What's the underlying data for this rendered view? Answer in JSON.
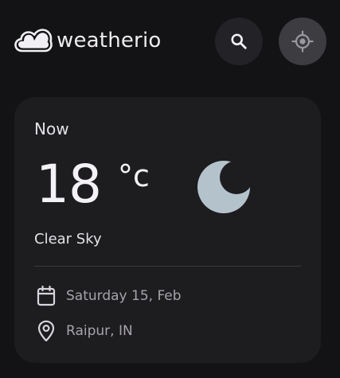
{
  "header": {
    "logo_text": "weatherio",
    "logo_icon": "cloud-icon",
    "search_icon": "search-icon",
    "location_icon": "current-location-icon"
  },
  "current": {
    "label": "Now",
    "temperature": "18",
    "unit": "°c",
    "condition": "Clear Sky",
    "condition_icon": "moon-icon",
    "date": "Saturday 15, Feb",
    "location": "Raipur, IN"
  },
  "colors": {
    "background": "#131214",
    "card": "#1d1c1f",
    "search_button": "#232226",
    "location_button": "#3d3c41",
    "moon": "#b4c2cc",
    "muted_text": "#a6a4aa"
  }
}
